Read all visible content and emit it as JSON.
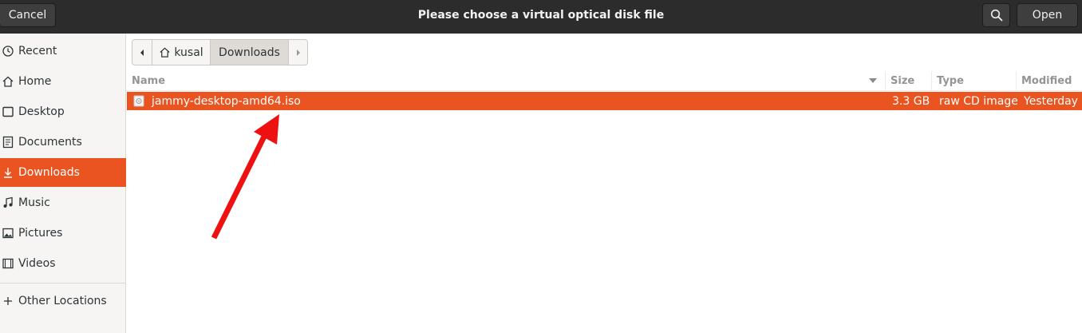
{
  "header": {
    "title": "Please choose a virtual optical disk file",
    "cancel_label": "Cancel",
    "open_label": "Open",
    "search_icon": "search-icon"
  },
  "sidebar": {
    "items": [
      {
        "label": "Recent",
        "icon": "clock-icon"
      },
      {
        "label": "Home",
        "icon": "home-icon"
      },
      {
        "label": "Desktop",
        "icon": "desktop-icon"
      },
      {
        "label": "Documents",
        "icon": "documents-icon"
      },
      {
        "label": "Downloads",
        "icon": "download-icon",
        "active": true
      },
      {
        "label": "Music",
        "icon": "music-icon"
      },
      {
        "label": "Pictures",
        "icon": "pictures-icon"
      },
      {
        "label": "Videos",
        "icon": "videos-icon"
      }
    ],
    "other_locations": {
      "label": "Other Locations",
      "icon": "plus-icon"
    }
  },
  "pathbar": {
    "segments": [
      "kusal",
      "Downloads"
    ],
    "current": "Downloads"
  },
  "file_list": {
    "columns": [
      "Name",
      "Size",
      "Type",
      "Modified"
    ],
    "sort_column": "Name",
    "rows": [
      {
        "name": "jammy-desktop-amd64.iso",
        "size": "3.3 GB",
        "type": "raw CD image",
        "modified": "Yesterday",
        "selected": true
      }
    ]
  },
  "colors": {
    "accent": "#e95420",
    "header_bg": "#2c2c2c",
    "annotation_arrow": "#ee1111"
  }
}
